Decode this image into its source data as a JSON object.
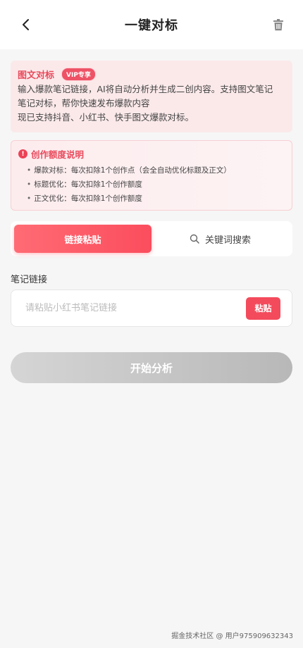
{
  "header": {
    "title": "一键对标",
    "back_icon": "chevron-left-icon",
    "delete_icon": "trash-icon"
  },
  "intro": {
    "title": "图文对标",
    "badge": "VIP专享",
    "lines": [
      "输入爆款笔记链接，AI将自动分析并生成二创内容。支持图文笔记",
      "笔记对标，帮你快速发布爆款内容",
      "现已支持抖音、小红书、快手图文爆款对标。"
    ]
  },
  "quota": {
    "title": "创作额度说明",
    "items": [
      "爆款对标：每次扣除1个创作点（会全自动优化标题及正文）",
      "标题优化：每次扣除1个创作额度",
      "正文优化：每次扣除1个创作额度"
    ]
  },
  "tabs": {
    "link_paste": "链接粘贴",
    "keyword_search": "关键词搜索"
  },
  "form": {
    "label": "笔记链接",
    "placeholder": "请粘贴小红书笔记链接",
    "value": "",
    "paste_label": "粘贴"
  },
  "actions": {
    "start_label": "开始分析"
  },
  "watermark": "掘金技术社区 @ 用户975909632343",
  "colors": {
    "accent": "#f34b5c",
    "accent_text": "#e84a5c",
    "intro_bg": "#fbe9ea",
    "disabled": "#c8c8c8"
  }
}
